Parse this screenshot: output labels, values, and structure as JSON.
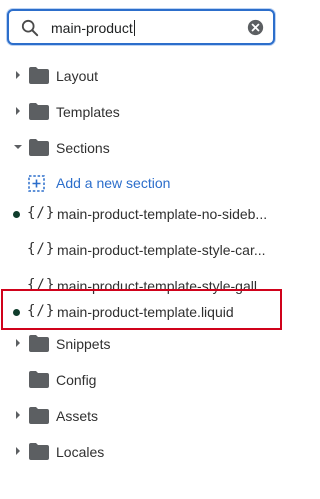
{
  "search": {
    "value": "main-product"
  },
  "tree": {
    "layout": "Layout",
    "templates": "Templates",
    "sections": "Sections",
    "add_section": "Add a new section",
    "files": [
      {
        "icon": "{/}",
        "name": "main-product-template-no-sideb..."
      },
      {
        "icon": "{/}",
        "name": "main-product-template-style-car..."
      },
      {
        "icon": "{/}",
        "name": "main-product-template-style-gall..."
      },
      {
        "icon": "{/}",
        "name": "main-product-template.liquid"
      }
    ],
    "snippets": "Snippets",
    "config": "Config",
    "assets": "Assets",
    "locales": "Locales"
  },
  "colors": {
    "accent": "#2c6ecb",
    "highlight": "#d0021b",
    "status_dot": "#0f3d2c"
  }
}
